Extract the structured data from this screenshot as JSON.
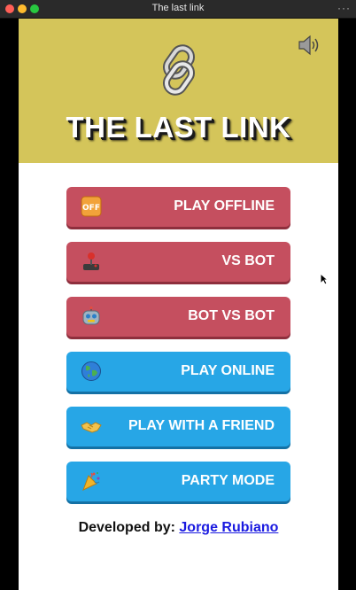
{
  "window": {
    "title": "The last link",
    "more": "···"
  },
  "header": {
    "title": "THE LAST LINK",
    "logo_icon": "chain-link-icon",
    "sound_icon": "speaker-icon"
  },
  "menu": [
    {
      "label": "PLAY OFFLINE",
      "icon": "offline-icon",
      "color": "#c54f5f"
    },
    {
      "label": "VS BOT",
      "icon": "joystick-icon",
      "color": "#c54f5f"
    },
    {
      "label": "BOT VS BOT",
      "icon": "robot-icon",
      "color": "#c54f5f"
    },
    {
      "label": "PLAY ONLINE",
      "icon": "globe-icon",
      "color": "#27a6e6"
    },
    {
      "label": "PLAY WITH A FRIEND",
      "icon": "handshake-icon",
      "color": "#27a6e6"
    },
    {
      "label": "PARTY MODE",
      "icon": "party-popper-icon",
      "color": "#27a6e6"
    }
  ],
  "footer": {
    "prefix": "Developed by:",
    "author": "Jorge Rubiano"
  },
  "colors": {
    "header_bg": "#d4c55a",
    "red_button": "#c54f5f",
    "blue_button": "#27a6e6",
    "link": "#1a1ae0"
  }
}
